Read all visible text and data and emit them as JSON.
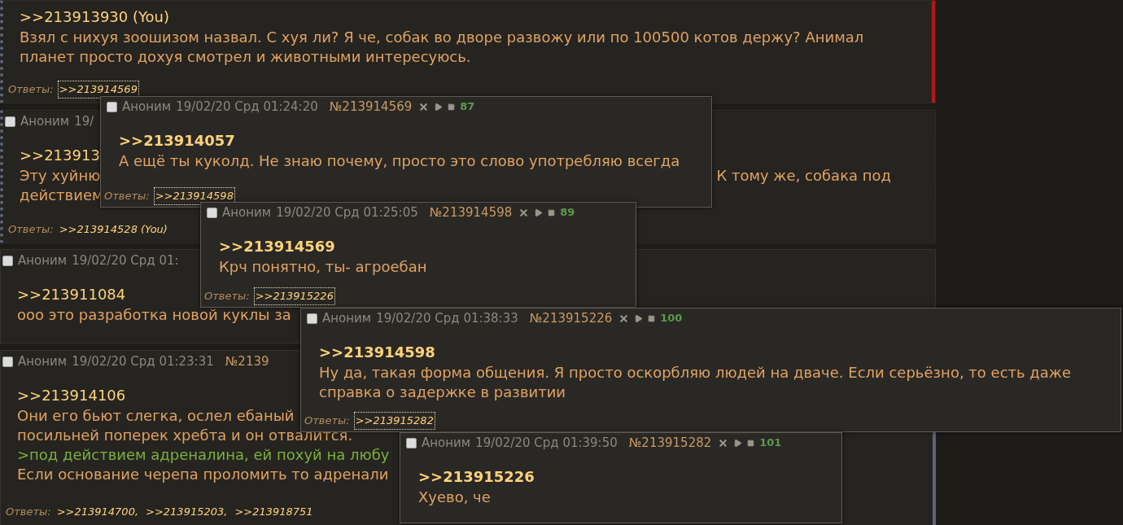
{
  "posts": [
    {
      "marked": true,
      "lines": [
        {
          "kind": "link",
          "parts": [
            ">>213913930 (You)"
          ]
        },
        {
          "kind": "text",
          "parts": [
            "Взял с нихуя зоошизом назвал. С хуя ли? Я че, собак во дворе развожу или по 100500 котов держу? Анимал"
          ]
        },
        {
          "kind": "text",
          "parts": [
            "планет просто дохуя смотрел и животными интересуюсь."
          ]
        }
      ],
      "replies": {
        "label": "Ответы:",
        "links": [
          {
            "text": ">>213914569",
            "highlighted": true
          }
        ]
      }
    },
    {
      "marked": false,
      "header": {
        "checked": false,
        "name": "Аноним",
        "meta": "19/"
      },
      "lines": [
        {
          "kind": "link",
          "parts": [
            ">>213913"
          ]
        },
        {
          "kind": "text",
          "parts": [
            "Эту хуйню",
            "К тому же, собака под"
          ]
        },
        {
          "kind": "text",
          "parts": [
            "действием"
          ]
        }
      ],
      "replies": {
        "label": "Ответы:",
        "links": [
          {
            "text": ">>213914528 (You)",
            "highlighted": false
          }
        ]
      }
    },
    {
      "marked": false,
      "header": {
        "checked": false,
        "name": "Аноним",
        "meta": "19/02/20 Срд 01:"
      },
      "lines": [
        {
          "kind": "link",
          "parts": [
            ">>213911084"
          ]
        },
        {
          "kind": "text",
          "parts": [
            "ооо это разработка новой куклы за"
          ]
        }
      ]
    },
    {
      "marked": false,
      "header": {
        "checked": false,
        "name": "Аноним",
        "meta": "19/02/20 Срд 01:23:31",
        "number": "№2139"
      },
      "lines": [
        {
          "kind": "link",
          "parts": [
            ">>213914106"
          ]
        },
        {
          "kind": "text",
          "parts": [
            "Они его бьют слегка, ослел ебаный"
          ]
        },
        {
          "kind": "text",
          "parts": [
            "посильней поперек хребта и он отвалится."
          ]
        },
        {
          "kind": "greentext",
          "parts": [
            ">под действием адреналина, ей похуй на любу"
          ]
        },
        {
          "kind": "text",
          "parts": [
            "Если основание черепа проломить то адренали"
          ]
        }
      ],
      "replies": {
        "label": "Ответы:",
        "links": [
          {
            "text": ">>213914700,",
            "highlighted": false
          },
          {
            "text": ">>213915203,",
            "highlighted": false
          },
          {
            "text": ">>213918751",
            "highlighted": false
          }
        ]
      }
    }
  ],
  "popups": [
    {
      "header": {
        "checked": false,
        "name": "Аноним",
        "meta": "19/02/20 Срд 01:24:20",
        "number": "№213914569",
        "count": "87"
      },
      "lines": [
        {
          "kind": "link",
          "parts": [
            ">>213914057"
          ]
        },
        {
          "kind": "text",
          "parts": [
            "А ещё ты куколд. Не знаю почему, просто это слово употребляю всегда"
          ]
        }
      ],
      "replies": {
        "label": "Ответы:",
        "links": [
          {
            "text": ">>213914598",
            "highlighted": true
          }
        ]
      }
    },
    {
      "header": {
        "checked": false,
        "name": "Аноним",
        "meta": "19/02/20 Срд 01:25:05",
        "number": "№213914598",
        "count": "89"
      },
      "lines": [
        {
          "kind": "link",
          "parts": [
            ">>213914569"
          ]
        },
        {
          "kind": "text",
          "parts": [
            "Крч понятно, ты- агроебан"
          ]
        }
      ],
      "replies": {
        "label": "Ответы:",
        "links": [
          {
            "text": ">>213915226",
            "highlighted": true
          }
        ]
      }
    },
    {
      "header": {
        "checked": false,
        "name": "Аноним",
        "meta": "19/02/20 Срд 01:38:33",
        "number": "№213915226",
        "count": "100"
      },
      "lines": [
        {
          "kind": "link",
          "parts": [
            ">>213914598"
          ]
        },
        {
          "kind": "text",
          "parts": [
            "Ну да, такая форма общения. Я просто оскорбляю людей на дваче. Если серьёзно, то есть даже"
          ]
        },
        {
          "kind": "text",
          "parts": [
            "справка о задержке в развитии"
          ]
        }
      ],
      "replies": {
        "label": "Ответы:",
        "links": [
          {
            "text": ">>213915282",
            "highlighted": true
          }
        ]
      }
    },
    {
      "header": {
        "checked": false,
        "name": "Аноним",
        "meta": "19/02/20 Срд 01:39:50",
        "number": "№213915282",
        "count": "101"
      },
      "lines": [
        {
          "kind": "link",
          "parts": [
            ">>213915226"
          ]
        },
        {
          "kind": "text",
          "parts": [
            "Хуево, че"
          ]
        }
      ]
    }
  ]
}
